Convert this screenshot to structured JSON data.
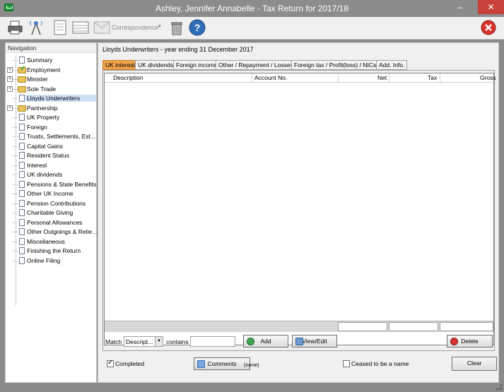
{
  "window": {
    "title": "Ashley, Jennifer Annabelle - Tax Return for 2017/18",
    "minimize": "–",
    "close": "✕"
  },
  "toolbar": {
    "correspondence_label": "Correspondence",
    "icons": [
      "print-icon",
      "communications-icon",
      "form-icon",
      "list-form-icon",
      "correspondence-icon",
      "bin-icon",
      "help-icon",
      "exit-icon"
    ]
  },
  "navigation": {
    "header": "Navigation",
    "items": [
      {
        "label": "Summary",
        "type": "doc"
      },
      {
        "label": "Employment",
        "type": "folder-check",
        "expandable": true
      },
      {
        "label": "Minister",
        "type": "folder",
        "expandable": true
      },
      {
        "label": "Sole Trade",
        "type": "folder",
        "expandable": true
      },
      {
        "label": "Lloyds Underwriters",
        "type": "doc",
        "selected": true
      },
      {
        "label": "Partnership",
        "type": "folder",
        "expandable": true
      },
      {
        "label": "UK Property",
        "type": "doc"
      },
      {
        "label": "Foreign",
        "type": "doc"
      },
      {
        "label": "Trusts, Settlements, Est...",
        "type": "doc"
      },
      {
        "label": "Capital Gains",
        "type": "doc"
      },
      {
        "label": "Resident Status",
        "type": "doc"
      },
      {
        "label": "Interest",
        "type": "doc"
      },
      {
        "label": "UK dividends",
        "type": "doc"
      },
      {
        "label": "Pensions & State Benefits",
        "type": "doc"
      },
      {
        "label": "Other UK Income",
        "type": "doc"
      },
      {
        "label": "Pension Contributions",
        "type": "doc"
      },
      {
        "label": "Charitable Giving",
        "type": "doc"
      },
      {
        "label": "Personal Allowances",
        "type": "doc"
      },
      {
        "label": "Other Outgoings & Relie...",
        "type": "doc"
      },
      {
        "label": "Miscellaneous",
        "type": "doc"
      },
      {
        "label": "Finishing the Return",
        "type": "doc"
      },
      {
        "label": "Online Filing",
        "type": "doc"
      }
    ]
  },
  "main": {
    "heading": "Lloyds Underwriters - year ending 31 December 2017",
    "tabs": [
      {
        "label": "UK interest",
        "active": true
      },
      {
        "label": "UK dividends"
      },
      {
        "label": "Foreign income"
      },
      {
        "label": "Other / Repayment / Losses"
      },
      {
        "label": "Foreign tax / Profit(loss) / NICs"
      },
      {
        "label": "Add. Info."
      }
    ],
    "columns": [
      "Description",
      "Account No.",
      "Net",
      "Tax",
      "Gross"
    ],
    "match_label": "Match",
    "match_value": "Descript...",
    "contains_label": "contains",
    "search_value": "",
    "add_label": "Add",
    "view_edit_label": "View/Edit",
    "delete_label": "Delete",
    "completed_label": "Completed",
    "completed_checked": true,
    "comments_label": "Comments",
    "comments_status": "(none)",
    "ceased_label": "Ceased to be a name",
    "ceased_checked": false,
    "clear_label": "Clear"
  }
}
